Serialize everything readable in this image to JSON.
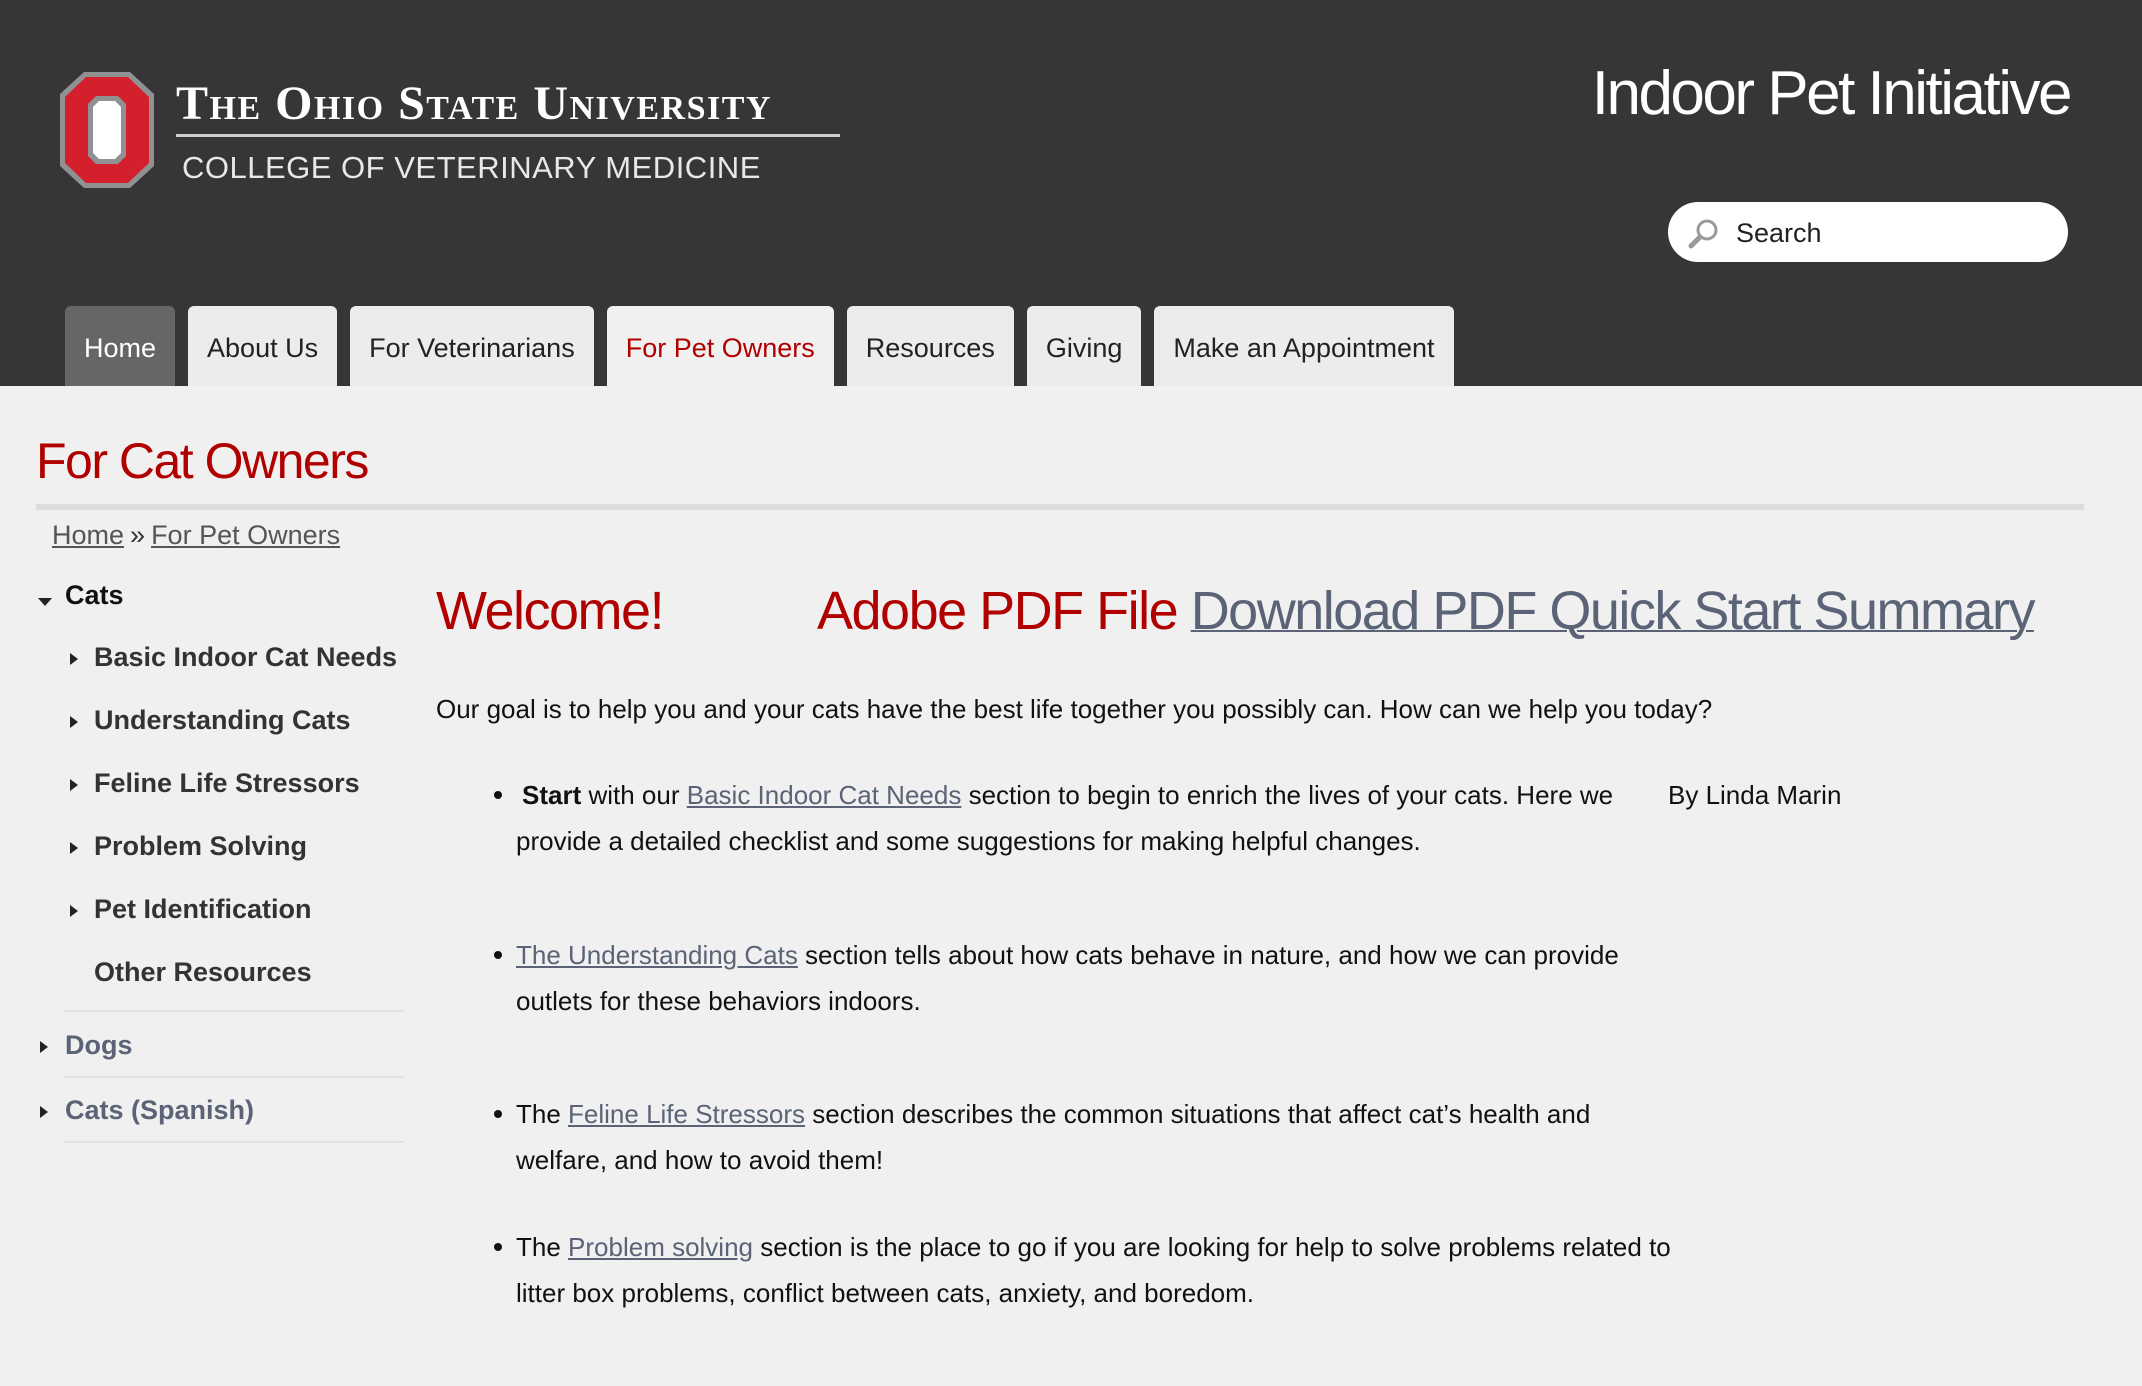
{
  "header": {
    "university_name": "The Ohio State University",
    "college_name": "COLLEGE OF VETERINARY MEDICINE",
    "site_title": "Indoor Pet Initiative",
    "search_placeholder": "Search",
    "colors": {
      "background": "#373537",
      "brand_red": "#b00000",
      "scarlet": "#d3202c"
    }
  },
  "nav": {
    "tabs": [
      {
        "label": "Home",
        "state": "home"
      },
      {
        "label": "About Us",
        "state": ""
      },
      {
        "label": "For Veterinarians",
        "state": ""
      },
      {
        "label": "For Pet Owners",
        "state": "active"
      },
      {
        "label": "Resources",
        "state": ""
      },
      {
        "label": "Giving",
        "state": ""
      },
      {
        "label": "Make an Appointment",
        "state": ""
      }
    ]
  },
  "page": {
    "title": "For Cat Owners",
    "breadcrumb": [
      {
        "label": "Home"
      },
      {
        "label": "For Pet Owners"
      }
    ],
    "breadcrumb_separator": "»"
  },
  "sidebar": {
    "cats_label": "Cats",
    "cat_items": [
      {
        "label": "Basic Indoor Cat Needs"
      },
      {
        "label": "Understanding Cats"
      },
      {
        "label": "Feline Life Stressors"
      },
      {
        "label": "Problem Solving"
      },
      {
        "label": "Pet Identification"
      },
      {
        "label": "Other Resources"
      }
    ],
    "dogs_label": "Dogs",
    "cats_spanish_label": "Cats (Spanish)"
  },
  "main": {
    "welcome": "Welcome!",
    "pdf_label": "Adobe PDF File",
    "pdf_link": "Download PDF Quick Start Summary",
    "intro": "Our goal is to help you and your cats have the best life together you possibly can. How can we help you today?",
    "author": "By Linda Marin",
    "bullets": [
      {
        "bold": "Start",
        "pre": " with our ",
        "link": "Basic Indoor Cat Needs",
        "post": " section to begin to enrich the lives of your cats. Here we provide a detailed checklist and some suggestions for making helpful changes."
      },
      {
        "bold": "",
        "pre": "",
        "link": "The Understanding Cats",
        "post": " section tells about how cats behave in nature, and how we can provide outlets for these behaviors indoors."
      },
      {
        "bold": "",
        "pre": " The ",
        "link": "Feline Life Stressors",
        "post": " section describes the common situations that affect cat’s health and welfare, and how to avoid them!"
      },
      {
        "bold": "",
        "pre": "The ",
        "link": "Problem solving",
        "post": " section is the place to go if you are looking for help to solve problems related to litter box problems, conflict between cats, anxiety, and boredom."
      }
    ]
  }
}
